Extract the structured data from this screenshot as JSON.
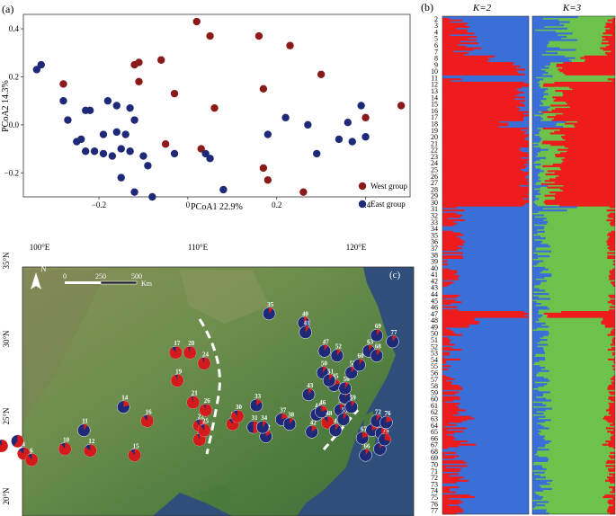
{
  "panels": {
    "a": {
      "label": "(a)"
    },
    "b": {
      "label": "(b)"
    },
    "c": {
      "label": "(c)"
    }
  },
  "colors": {
    "west": "#8B1A1A",
    "east": "#1E2A78",
    "k_red": "#EE1C1C",
    "k_blue": "#3A6FD8",
    "k_green": "#6CC24A",
    "land": "#5F8A4A",
    "sea": "#2F4E7A"
  },
  "chart_data": [
    {
      "type": "scatter",
      "title": "",
      "xlabel": "PCoA1 22.9%",
      "ylabel": "PCoA2 14.3%",
      "xlim": [
        -0.37,
        0.5
      ],
      "ylim": [
        -0.3,
        0.46
      ],
      "xticks": [
        -0.2,
        0,
        0.2,
        0.4
      ],
      "xtick_labels": [
        "−0.2",
        "0",
        "0.2",
        "0.4"
      ],
      "yticks": [
        -0.2,
        0,
        0.2,
        0.4
      ],
      "ytick_labels": [
        "−0.2",
        "0.0",
        "0.2",
        "0.4"
      ],
      "legend_position": "bottom-right",
      "series": [
        {
          "name": "West group",
          "color": "#8B1A1A",
          "points": [
            [
              0.02,
              0.43
            ],
            [
              0.05,
              0.37
            ],
            [
              0.16,
              0.37
            ],
            [
              0.23,
              0.33
            ],
            [
              -0.06,
              0.27
            ],
            [
              -0.11,
              0.26
            ],
            [
              -0.12,
              0.25
            ],
            [
              -0.11,
              0.18
            ],
            [
              -0.28,
              0.17
            ],
            [
              -0.03,
              0.13
            ],
            [
              0.17,
              0.15
            ],
            [
              0.3,
              0.21
            ],
            [
              0.06,
              0.07
            ],
            [
              0.48,
              0.08
            ],
            [
              0.4,
              0.03
            ],
            [
              -0.05,
              -0.08
            ],
            [
              0.03,
              -0.1
            ],
            [
              0.17,
              -0.18
            ],
            [
              0.18,
              -0.23
            ],
            [
              0.26,
              -0.28
            ]
          ]
        },
        {
          "name": "East group",
          "color": "#1E2A78",
          "points": [
            [
              -0.33,
              0.25
            ],
            [
              -0.34,
              0.23
            ],
            [
              -0.28,
              0.1
            ],
            [
              -0.23,
              0.06
            ],
            [
              -0.22,
              0.06
            ],
            [
              -0.18,
              0.1
            ],
            [
              -0.16,
              0.08
            ],
            [
              -0.13,
              0.07
            ],
            [
              -0.12,
              0.02
            ],
            [
              -0.16,
              -0.03
            ],
            [
              -0.14,
              -0.04
            ],
            [
              -0.19,
              -0.04
            ],
            [
              -0.25,
              -0.07
            ],
            [
              -0.24,
              -0.06
            ],
            [
              -0.23,
              -0.11
            ],
            [
              -0.19,
              -0.12
            ],
            [
              -0.21,
              -0.11
            ],
            [
              -0.17,
              -0.13
            ],
            [
              -0.15,
              -0.1
            ],
            [
              -0.13,
              -0.11
            ],
            [
              -0.1,
              -0.13
            ],
            [
              -0.15,
              -0.22
            ],
            [
              -0.09,
              -0.17
            ],
            [
              -0.12,
              -0.28
            ],
            [
              -0.08,
              -0.3
            ],
            [
              -0.03,
              -0.12
            ],
            [
              0.04,
              -0.12
            ],
            [
              0.05,
              -0.14
            ],
            [
              0.08,
              -0.27
            ],
            [
              -0.27,
              0.02
            ],
            [
              0.18,
              -0.04
            ],
            [
              0.22,
              0.03
            ],
            [
              0.27,
              0.0
            ],
            [
              0.29,
              -0.12
            ],
            [
              0.34,
              -0.06
            ],
            [
              0.36,
              0.01
            ],
            [
              0.37,
              -0.07
            ],
            [
              0.39,
              0.08
            ],
            [
              0.4,
              -0.05
            ]
          ]
        }
      ]
    },
    {
      "type": "bar",
      "title": "",
      "panels": [
        "K=2",
        "K=3"
      ],
      "row_labels": [
        "2",
        "3",
        "4",
        "5",
        "6",
        "7",
        "8",
        "9",
        "10",
        "11",
        "12",
        "13",
        "14",
        "15",
        "16",
        "17",
        "18",
        "19",
        "20",
        "21",
        "22",
        "23",
        "24",
        "25",
        "26",
        "27",
        "28",
        "29",
        "30",
        "31",
        "32",
        "33",
        "34",
        "35",
        "36",
        "37",
        "38",
        "39",
        "40",
        "41",
        "42",
        "43",
        "44",
        "45",
        "46",
        "47",
        "48",
        "49",
        "50",
        "51",
        "52",
        "53",
        "54",
        "55",
        "56",
        "57",
        "58",
        "59",
        "60",
        "61",
        "62",
        "63",
        "64",
        "65",
        "66",
        "67",
        "68",
        "69",
        "70",
        "71",
        "72",
        "73",
        "74",
        "75",
        "76",
        "77"
      ],
      "k2_red_fraction": [
        0.15,
        0.2,
        0.22,
        0.25,
        0.3,
        0.28,
        0.55,
        0.85,
        0.9,
        0.05,
        0.95,
        0.92,
        0.9,
        0.93,
        0.95,
        0.96,
        0.7,
        0.95,
        0.98,
        0.97,
        0.96,
        0.97,
        0.98,
        0.97,
        0.96,
        0.95,
        0.97,
        0.98,
        0.99,
        0.1,
        0.12,
        0.1,
        0.08,
        0.1,
        0.12,
        0.1,
        0.08,
        0.07,
        0.09,
        0.1,
        0.08,
        0.06,
        0.07,
        0.05,
        0.08,
        0.95,
        0.3,
        0.2,
        0.1,
        0.08,
        0.07,
        0.06,
        0.08,
        0.1,
        0.06,
        0.05,
        0.06,
        0.07,
        0.1,
        0.12,
        0.15,
        0.2,
        0.18,
        0.2,
        0.15,
        0.22,
        0.1,
        0.1,
        0.12,
        0.1,
        0.15,
        0.12,
        0.1,
        0.2,
        0.22,
        0.1
      ],
      "k3_segments_note": "blue | green | red per individual"
    }
  ],
  "scatter_legend": {
    "west": "West group",
    "east": "East group"
  },
  "admixture": {
    "k2_title": "K=2",
    "k3_title": "K=3"
  },
  "map": {
    "lon_labels": [
      "100°E",
      "110°E",
      "120°E"
    ],
    "lat_labels": [
      "35°N",
      "30°N",
      "25°N",
      "20°N"
    ],
    "north_label": "N",
    "scale_labels": [
      "0",
      "250",
      "500"
    ],
    "scale_unit": "Km",
    "pies": [
      {
        "id": "2",
        "lon": 97.6,
        "lat": 23.5,
        "west": 0.9
      },
      {
        "id": "3",
        "lon": 98.6,
        "lat": 23.8,
        "west": 0.6
      },
      {
        "id": "4",
        "lon": 99.0,
        "lat": 23.0,
        "west": 0.85
      },
      {
        "id": "6",
        "lon": 99.5,
        "lat": 22.6,
        "west": 0.9
      },
      {
        "id": "10",
        "lon": 101.6,
        "lat": 23.3,
        "west": 0.9
      },
      {
        "id": "11",
        "lon": 102.8,
        "lat": 24.5,
        "west": 0.1
      },
      {
        "id": "12",
        "lon": 103.2,
        "lat": 23.2,
        "west": 0.85
      },
      {
        "id": "14",
        "lon": 105.3,
        "lat": 26.0,
        "west": 0.2
      },
      {
        "id": "15",
        "lon": 106.0,
        "lat": 22.9,
        "west": 0.9
      },
      {
        "id": "16",
        "lon": 106.8,
        "lat": 25.1,
        "west": 0.9
      },
      {
        "id": "17",
        "lon": 108.6,
        "lat": 29.5,
        "west": 0.9
      },
      {
        "id": "19",
        "lon": 108.7,
        "lat": 27.7,
        "west": 0.95
      },
      {
        "id": "20",
        "lon": 109.5,
        "lat": 29.5,
        "west": 0.95
      },
      {
        "id": "21",
        "lon": 109.7,
        "lat": 26.3,
        "west": 0.95
      },
      {
        "id": "22",
        "lon": 110.1,
        "lat": 24.8,
        "west": 0.9
      },
      {
        "id": "23",
        "lon": 110.1,
        "lat": 23.9,
        "west": 0.95
      },
      {
        "id": "24",
        "lon": 110.4,
        "lat": 28.8,
        "west": 0.95
      },
      {
        "id": "25",
        "lon": 110.4,
        "lat": 24.5,
        "west": 0.9
      },
      {
        "id": "26",
        "lon": 110.5,
        "lat": 25.8,
        "west": 0.95
      },
      {
        "id": "29",
        "lon": 112.2,
        "lat": 24.9,
        "west": 0.9
      },
      {
        "id": "30",
        "lon": 112.5,
        "lat": 25.4,
        "west": 0.9
      },
      {
        "id": "31",
        "lon": 113.5,
        "lat": 24.7,
        "west": 0.5
      },
      {
        "id": "32",
        "lon": 114.3,
        "lat": 24.1,
        "west": 0.15
      },
      {
        "id": "33",
        "lon": 113.7,
        "lat": 26.1,
        "west": 0.15
      },
      {
        "id": "34",
        "lon": 114.1,
        "lat": 24.7,
        "west": 0.1
      },
      {
        "id": "35",
        "lon": 114.5,
        "lat": 32.0,
        "west": 0.1
      },
      {
        "id": "37",
        "lon": 115.3,
        "lat": 25.2,
        "west": 0.2
      },
      {
        "id": "38",
        "lon": 115.8,
        "lat": 24.9,
        "west": 0.1
      },
      {
        "id": "40",
        "lon": 116.7,
        "lat": 31.4,
        "west": 0.1
      },
      {
        "id": "41",
        "lon": 116.8,
        "lat": 30.8,
        "west": 0.1
      },
      {
        "id": "42",
        "lon": 117.2,
        "lat": 24.4,
        "west": 0.15
      },
      {
        "id": "43",
        "lon": 117.0,
        "lat": 26.8,
        "west": 0.1
      },
      {
        "id": "44",
        "lon": 117.5,
        "lat": 25.5,
        "west": 0.3
      },
      {
        "id": "45",
        "lon": 118.6,
        "lat": 27.4,
        "west": 0.2
      },
      {
        "id": "46",
        "lon": 117.8,
        "lat": 25.7,
        "west": 0.2
      },
      {
        "id": "47",
        "lon": 118.0,
        "lat": 29.6,
        "west": 0.1
      },
      {
        "id": "48",
        "lon": 118.2,
        "lat": 25.0,
        "west": 0.9
      },
      {
        "id": "49",
        "lon": 118.7,
        "lat": 24.5,
        "west": 0.1
      },
      {
        "id": "50",
        "lon": 117.9,
        "lat": 28.2,
        "west": 0.1
      },
      {
        "id": "51",
        "lon": 118.3,
        "lat": 27.7,
        "west": 0.1
      },
      {
        "id": "52",
        "lon": 118.8,
        "lat": 29.3,
        "west": 0.1
      },
      {
        "id": "53",
        "lon": 119.0,
        "lat": 25.8,
        "west": 0.1
      },
      {
        "id": "54",
        "lon": 119.3,
        "lat": 26.6,
        "west": 0.1
      },
      {
        "id": "55",
        "lon": 119.2,
        "lat": 25.2,
        "west": 0.1
      },
      {
        "id": "56",
        "lon": 119.3,
        "lat": 27.2,
        "west": 0.1
      },
      {
        "id": "57",
        "lon": 119.7,
        "lat": 28.2,
        "west": 0.1
      },
      {
        "id": "59",
        "lon": 119.7,
        "lat": 26.0,
        "west": 0.1
      },
      {
        "id": "60",
        "lon": 120.2,
        "lat": 28.7,
        "west": 0.1
      },
      {
        "id": "63",
        "lon": 120.8,
        "lat": 29.6,
        "west": 0.1
      },
      {
        "id": "65",
        "lon": 121.0,
        "lat": 24.5,
        "west": 0.2
      },
      {
        "id": "66",
        "lon": 120.6,
        "lat": 22.9,
        "west": 0.1
      },
      {
        "id": "67",
        "lon": 120.4,
        "lat": 24.0,
        "west": 0.2
      },
      {
        "id": "68",
        "lon": 121.3,
        "lat": 29.3,
        "west": 0.1
      },
      {
        "id": "69",
        "lon": 121.3,
        "lat": 30.6,
        "west": 0.1
      },
      {
        "id": "71",
        "lon": 121.6,
        "lat": 24.3,
        "west": 0.3
      },
      {
        "id": "72",
        "lon": 121.3,
        "lat": 25.1,
        "west": 0.1
      },
      {
        "id": "73",
        "lon": 121.5,
        "lat": 23.3,
        "west": 0.1
      },
      {
        "id": "75",
        "lon": 121.8,
        "lat": 23.9,
        "west": 0.3
      },
      {
        "id": "76",
        "lon": 121.9,
        "lat": 25.0,
        "west": 0.2
      },
      {
        "id": "77",
        "lon": 122.3,
        "lat": 30.2,
        "west": 0.1
      }
    ]
  }
}
